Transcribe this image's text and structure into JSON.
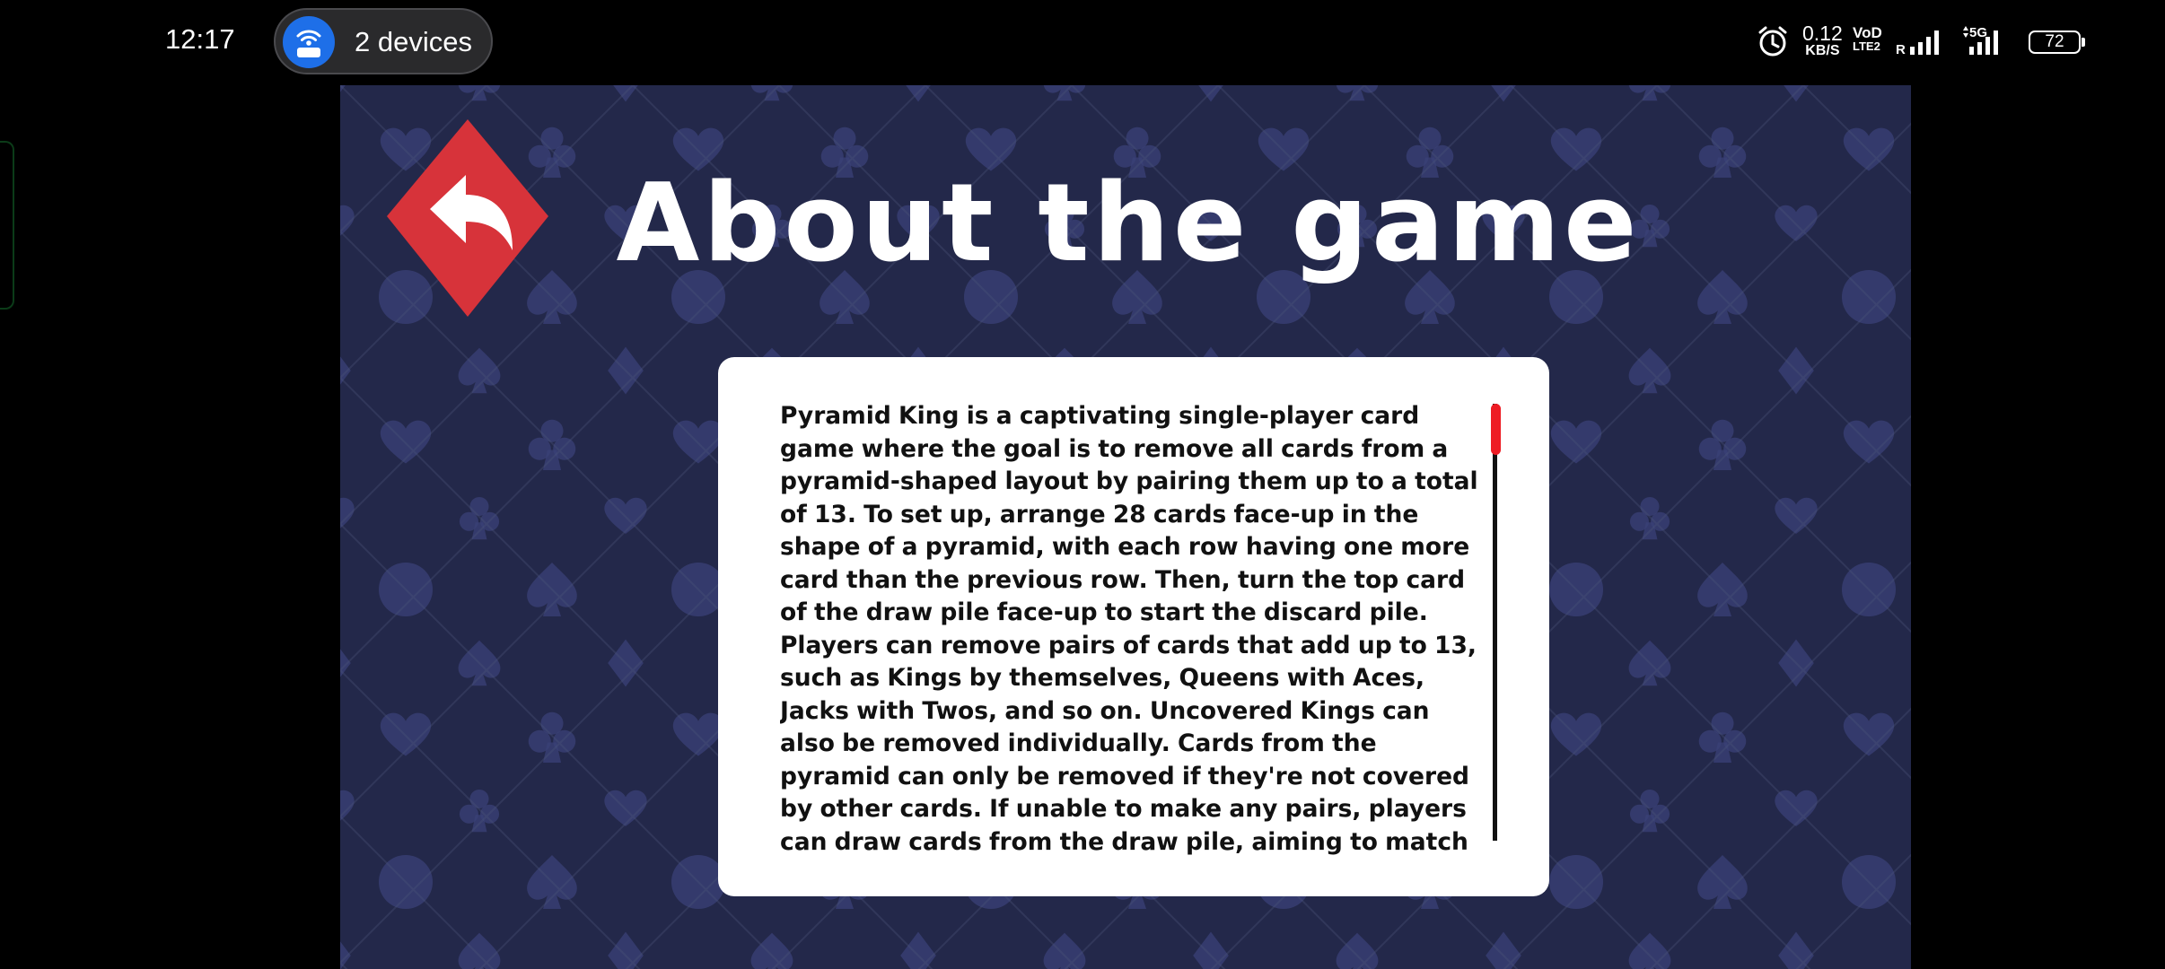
{
  "status_bar": {
    "time": "12:17",
    "hotspot": {
      "label": "2 devices",
      "icon": "wifi-hotspot-icon"
    },
    "network_speed": {
      "value": "0.12",
      "unit": "KB/S"
    },
    "volte": {
      "top": "VoD",
      "bottom": "LTE2"
    },
    "sim1_label": "R",
    "sim2_label": "5G",
    "battery_level": "72"
  },
  "game": {
    "title": "About the game",
    "back_button_icon": "back-arrow-icon",
    "accent_color": "#d7333a",
    "background_color": "#23284a",
    "about_text": "Pyramid King is a captivating single-player card game where the goal is to remove all cards from a pyramid-shaped layout by pairing them up to a total of 13. To set up, arrange 28 cards face-up in the shape of a pyramid, with each row having one more card than the previous row. Then, turn the top card of the draw pile face-up to start the discard pile. Players can remove pairs of cards that add up to 13, such as Kings by themselves, Queens with Aces, Jacks with Twos, and so on. Uncovered Kings can also be removed individually. Cards from the pyramid can only be removed if they're not covered by other cards. If unable to make any pairs, players can draw cards from the draw pile, aiming to match them with cards from the",
    "scroll_position": 0.0,
    "scroll_thumb_color": "#ee1c24"
  }
}
